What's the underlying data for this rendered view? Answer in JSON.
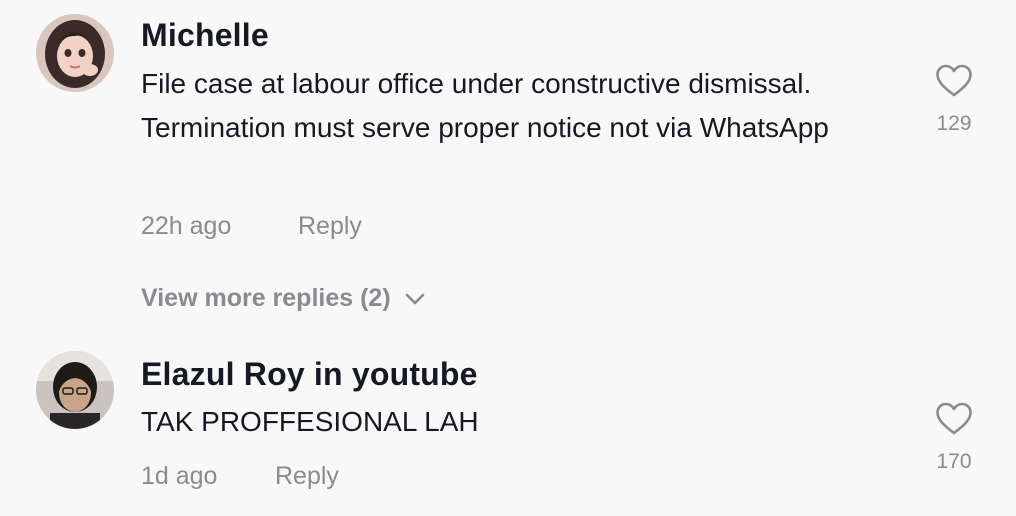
{
  "comments": [
    {
      "author": "Michelle",
      "text": "File case at labour office under constructive dismissal. Termination must serve proper notice not via WhatsApp",
      "time": "22h ago",
      "reply_label": "Reply",
      "likes": "129",
      "view_more": "View more replies (2)"
    },
    {
      "author": "Elazul Roy in youtube",
      "text": "TAK PROFFESIONAL LAH",
      "time": "1d ago",
      "reply_label": "Reply",
      "likes": "170"
    }
  ],
  "colors": {
    "background": "#f8f8f8",
    "text_primary": "#161823",
    "text_secondary": "#8a8b91"
  },
  "icons": {
    "like": "heart-outline-icon",
    "expand": "chevron-down-icon"
  }
}
